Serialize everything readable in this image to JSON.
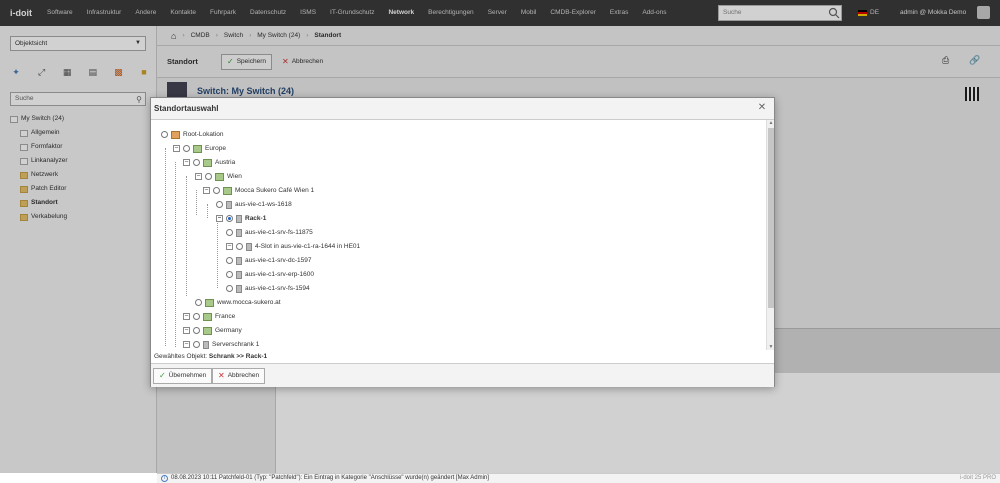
{
  "nav": {
    "logo": "i-doit",
    "items": [
      "Software",
      "Infrastruktur",
      "Andere",
      "Kontakte",
      "Fuhrpark",
      "Datenschutz",
      "ISMS",
      "IT-Grundschutz",
      "Network",
      "Berechtigungen",
      "Server",
      "Mobil",
      "CMDB-Explorer",
      "Extras",
      "Add-ons"
    ],
    "active": "Network",
    "search_placeholder": "Suche",
    "lang": "DE",
    "user": "admin @ Mokka Demo"
  },
  "left": {
    "select_value": "Objektsicht",
    "search_placeholder": "Suche",
    "tree": [
      {
        "label": "My Switch (24)",
        "level": 0,
        "bold": false
      },
      {
        "label": "Allgemein",
        "level": 1
      },
      {
        "label": "Formfaktor",
        "level": 1
      },
      {
        "label": "Linkanalyzer",
        "level": 1
      },
      {
        "label": "Netzwerk",
        "level": 1,
        "folder": true
      },
      {
        "label": "Patch Editor",
        "level": 1,
        "folder": true
      },
      {
        "label": "Standort",
        "level": 1,
        "folder": true,
        "bold": true
      },
      {
        "label": "Verkabelung",
        "level": 1,
        "folder": true
      }
    ]
  },
  "breadcrumb": {
    "items": [
      "CMDB",
      "Switch",
      "My Switch (24)"
    ],
    "current": "Standort"
  },
  "toolbar": {
    "title": "Standort",
    "save_label": "Speichern",
    "cancel_label": "Abbrechen"
  },
  "main": {
    "object_header": "Switch: My Switch (24)"
  },
  "modal": {
    "title": "Standortauswahl",
    "tree": [
      "Root-Lokation",
      "Europe",
      "Austria",
      "Wien",
      "Mocca Sukero Café Wien 1",
      "aus-vie-c1-ws-1618",
      "Rack-1",
      "aus-vie-c1-srv-fs-11875",
      "4-Slot in aus-vie-c1-ra-1644 in HE01",
      "aus-vie-c1-srv-dc-1597",
      "aus-vie-c1-srv-erp-1600",
      "aus-vie-c1-srv-fs-1594",
      "www.mocca-sukero.at",
      "France",
      "Germany",
      "Serverschrank 1"
    ],
    "selected_prefix": "Gewähltes Objekt:",
    "selected_value": "Schrank >> Rack-1",
    "apply_label": "Übernehmen",
    "cancel_label": "Abbrechen"
  },
  "status": {
    "message": "08.08.2023 10:11 Patchfeld-01 (Typ: \"Patchfeld\"): Ein Eintrag in Kategorie \"Anschlüsse\" wurde(n) geändert [Max Admin]",
    "right": "i-doit 25 PRO"
  }
}
